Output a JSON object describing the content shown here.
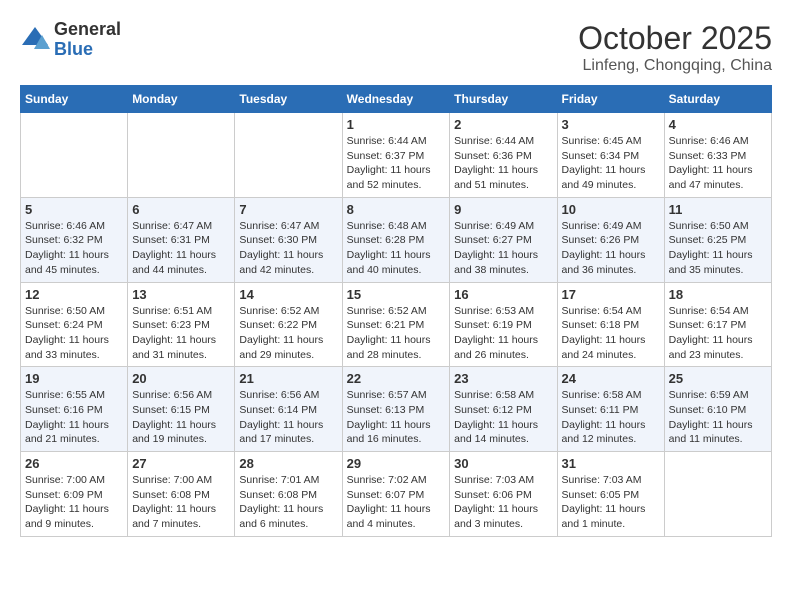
{
  "header": {
    "logo_general": "General",
    "logo_blue": "Blue",
    "month_title": "October 2025",
    "location": "Linfeng, Chongqing, China"
  },
  "weekdays": [
    "Sunday",
    "Monday",
    "Tuesday",
    "Wednesday",
    "Thursday",
    "Friday",
    "Saturday"
  ],
  "weeks": [
    [
      {
        "day": "",
        "info": ""
      },
      {
        "day": "",
        "info": ""
      },
      {
        "day": "",
        "info": ""
      },
      {
        "day": "1",
        "info": "Sunrise: 6:44 AM\nSunset: 6:37 PM\nDaylight: 11 hours\nand 52 minutes."
      },
      {
        "day": "2",
        "info": "Sunrise: 6:44 AM\nSunset: 6:36 PM\nDaylight: 11 hours\nand 51 minutes."
      },
      {
        "day": "3",
        "info": "Sunrise: 6:45 AM\nSunset: 6:34 PM\nDaylight: 11 hours\nand 49 minutes."
      },
      {
        "day": "4",
        "info": "Sunrise: 6:46 AM\nSunset: 6:33 PM\nDaylight: 11 hours\nand 47 minutes."
      }
    ],
    [
      {
        "day": "5",
        "info": "Sunrise: 6:46 AM\nSunset: 6:32 PM\nDaylight: 11 hours\nand 45 minutes."
      },
      {
        "day": "6",
        "info": "Sunrise: 6:47 AM\nSunset: 6:31 PM\nDaylight: 11 hours\nand 44 minutes."
      },
      {
        "day": "7",
        "info": "Sunrise: 6:47 AM\nSunset: 6:30 PM\nDaylight: 11 hours\nand 42 minutes."
      },
      {
        "day": "8",
        "info": "Sunrise: 6:48 AM\nSunset: 6:28 PM\nDaylight: 11 hours\nand 40 minutes."
      },
      {
        "day": "9",
        "info": "Sunrise: 6:49 AM\nSunset: 6:27 PM\nDaylight: 11 hours\nand 38 minutes."
      },
      {
        "day": "10",
        "info": "Sunrise: 6:49 AM\nSunset: 6:26 PM\nDaylight: 11 hours\nand 36 minutes."
      },
      {
        "day": "11",
        "info": "Sunrise: 6:50 AM\nSunset: 6:25 PM\nDaylight: 11 hours\nand 35 minutes."
      }
    ],
    [
      {
        "day": "12",
        "info": "Sunrise: 6:50 AM\nSunset: 6:24 PM\nDaylight: 11 hours\nand 33 minutes."
      },
      {
        "day": "13",
        "info": "Sunrise: 6:51 AM\nSunset: 6:23 PM\nDaylight: 11 hours\nand 31 minutes."
      },
      {
        "day": "14",
        "info": "Sunrise: 6:52 AM\nSunset: 6:22 PM\nDaylight: 11 hours\nand 29 minutes."
      },
      {
        "day": "15",
        "info": "Sunrise: 6:52 AM\nSunset: 6:21 PM\nDaylight: 11 hours\nand 28 minutes."
      },
      {
        "day": "16",
        "info": "Sunrise: 6:53 AM\nSunset: 6:19 PM\nDaylight: 11 hours\nand 26 minutes."
      },
      {
        "day": "17",
        "info": "Sunrise: 6:54 AM\nSunset: 6:18 PM\nDaylight: 11 hours\nand 24 minutes."
      },
      {
        "day": "18",
        "info": "Sunrise: 6:54 AM\nSunset: 6:17 PM\nDaylight: 11 hours\nand 23 minutes."
      }
    ],
    [
      {
        "day": "19",
        "info": "Sunrise: 6:55 AM\nSunset: 6:16 PM\nDaylight: 11 hours\nand 21 minutes."
      },
      {
        "day": "20",
        "info": "Sunrise: 6:56 AM\nSunset: 6:15 PM\nDaylight: 11 hours\nand 19 minutes."
      },
      {
        "day": "21",
        "info": "Sunrise: 6:56 AM\nSunset: 6:14 PM\nDaylight: 11 hours\nand 17 minutes."
      },
      {
        "day": "22",
        "info": "Sunrise: 6:57 AM\nSunset: 6:13 PM\nDaylight: 11 hours\nand 16 minutes."
      },
      {
        "day": "23",
        "info": "Sunrise: 6:58 AM\nSunset: 6:12 PM\nDaylight: 11 hours\nand 14 minutes."
      },
      {
        "day": "24",
        "info": "Sunrise: 6:58 AM\nSunset: 6:11 PM\nDaylight: 11 hours\nand 12 minutes."
      },
      {
        "day": "25",
        "info": "Sunrise: 6:59 AM\nSunset: 6:10 PM\nDaylight: 11 hours\nand 11 minutes."
      }
    ],
    [
      {
        "day": "26",
        "info": "Sunrise: 7:00 AM\nSunset: 6:09 PM\nDaylight: 11 hours\nand 9 minutes."
      },
      {
        "day": "27",
        "info": "Sunrise: 7:00 AM\nSunset: 6:08 PM\nDaylight: 11 hours\nand 7 minutes."
      },
      {
        "day": "28",
        "info": "Sunrise: 7:01 AM\nSunset: 6:08 PM\nDaylight: 11 hours\nand 6 minutes."
      },
      {
        "day": "29",
        "info": "Sunrise: 7:02 AM\nSunset: 6:07 PM\nDaylight: 11 hours\nand 4 minutes."
      },
      {
        "day": "30",
        "info": "Sunrise: 7:03 AM\nSunset: 6:06 PM\nDaylight: 11 hours\nand 3 minutes."
      },
      {
        "day": "31",
        "info": "Sunrise: 7:03 AM\nSunset: 6:05 PM\nDaylight: 11 hours\nand 1 minute."
      },
      {
        "day": "",
        "info": ""
      }
    ]
  ]
}
